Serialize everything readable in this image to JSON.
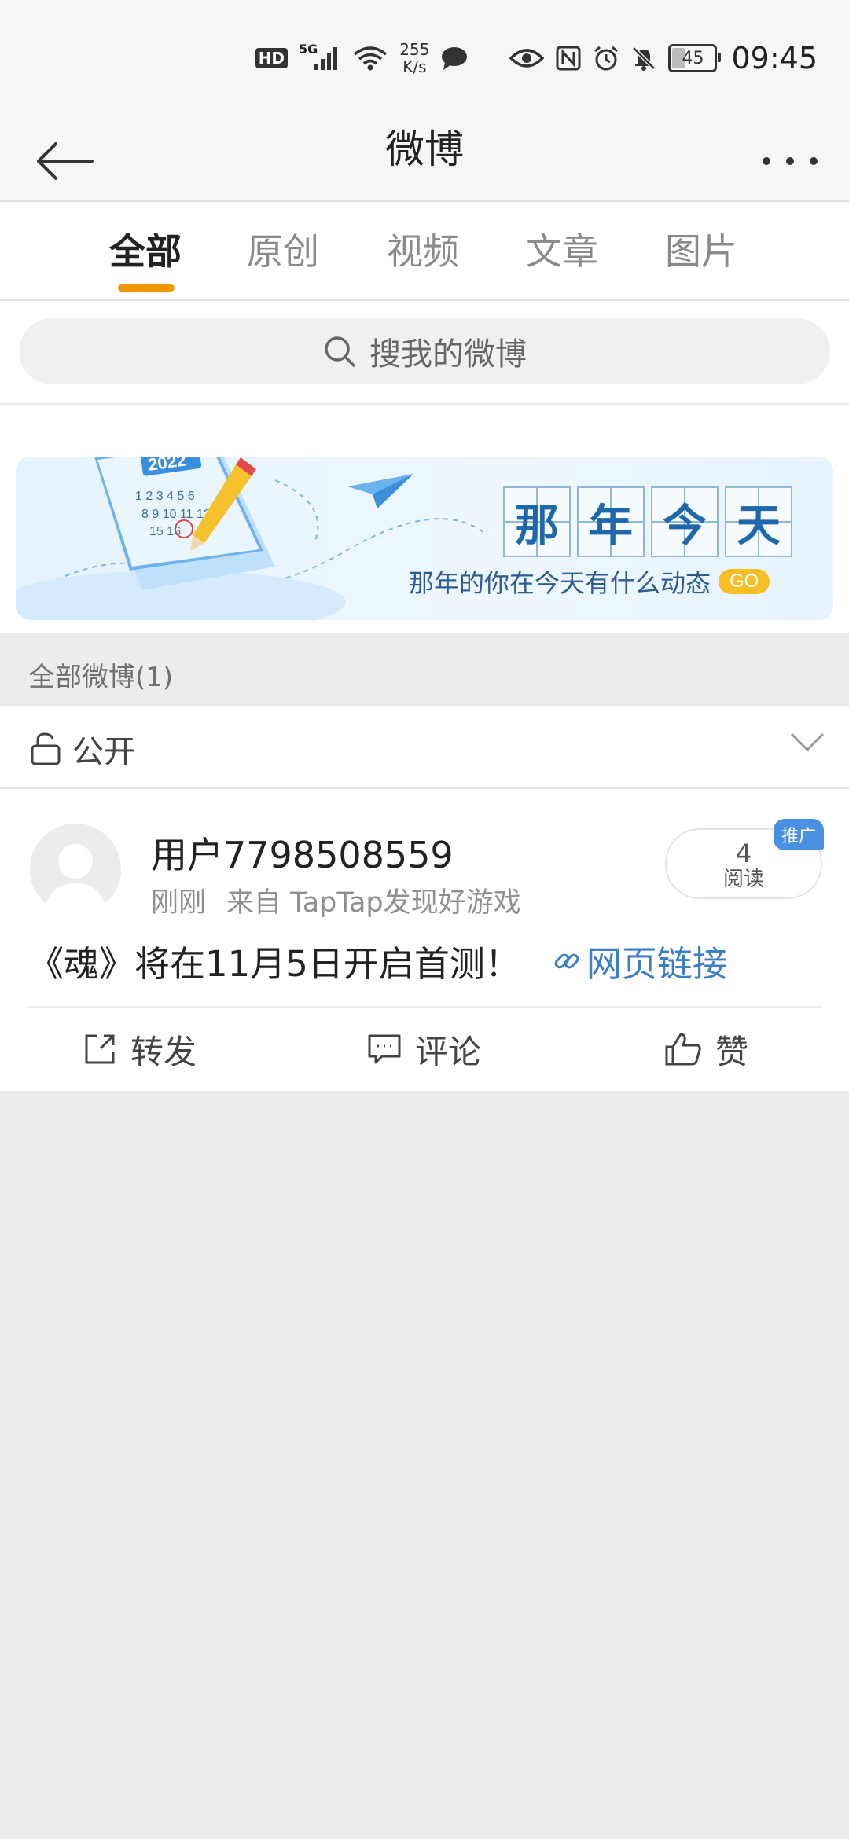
{
  "status_bar": {
    "hd": "HD",
    "network": "5G",
    "speed_value": "255",
    "speed_unit": "K/s",
    "battery": "45",
    "time": "09:45"
  },
  "header": {
    "title": "微博"
  },
  "tabs": [
    {
      "label": "全部",
      "active": true
    },
    {
      "label": "原创",
      "active": false
    },
    {
      "label": "视频",
      "active": false
    },
    {
      "label": "文章",
      "active": false
    },
    {
      "label": "图片",
      "active": false
    }
  ],
  "search": {
    "placeholder": "搜我的微博"
  },
  "banner": {
    "calendar_year": "2022",
    "title_chars": [
      "那",
      "年",
      "今",
      "天"
    ],
    "subtitle": "那年的你在今天有什么动态",
    "go_label": "GO"
  },
  "section": {
    "title": "全部微博(1)"
  },
  "visibility": {
    "label": "公开"
  },
  "post": {
    "username": "用户7798508559",
    "time": "刚刚",
    "source": "来自 TapTap发现好游戏",
    "read_count": "4",
    "read_label": "阅读",
    "promo_tag": "推广",
    "content": "《魂》将在11月5日开启首测！",
    "link_label": "网页链接",
    "actions": {
      "repost": "转发",
      "comment": "评论",
      "like": "赞"
    }
  },
  "colors": {
    "accent": "#f29600",
    "link": "#3d7fc7",
    "promo": "#4a90e2"
  }
}
